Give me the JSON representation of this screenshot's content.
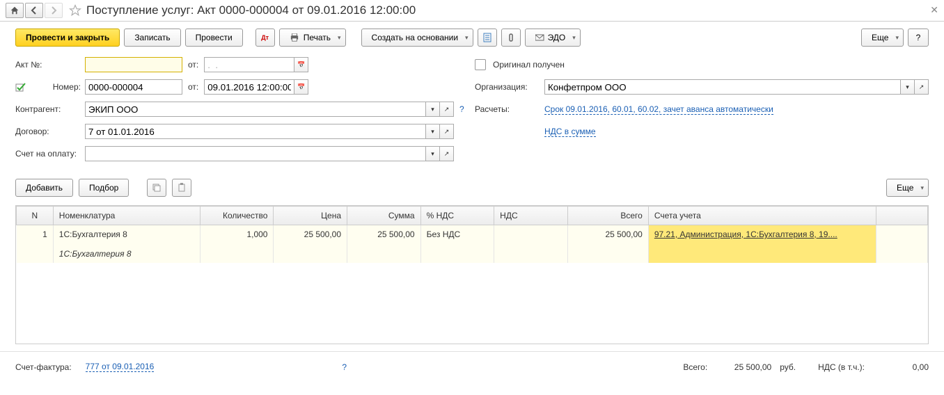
{
  "title": "Поступление услуг: Акт 0000-000004 от 09.01.2016 12:00:00",
  "toolbar": {
    "post_close": "Провести и закрыть",
    "save": "Записать",
    "post": "Провести",
    "print": "Печать",
    "create_based": "Создать на основании",
    "edo": "ЭДО",
    "more": "Еще",
    "help": "?"
  },
  "form": {
    "act_no_label": "Акт №:",
    "act_no_value": "",
    "from1": "от:",
    "date1": ".  .",
    "number_label": "Номер:",
    "number_value": "0000-000004",
    "from2": "от:",
    "date2": "09.01.2016 12:00:00",
    "counterparty_label": "Контрагент:",
    "counterparty_value": "ЭКИП ООО",
    "contract_label": "Договор:",
    "contract_value": "7 от 01.01.2016",
    "invoice_label": "Счет на оплату:",
    "invoice_value": "",
    "orig_received": "Оригинал получен",
    "org_label": "Организация:",
    "org_value": "Конфетпром ООО",
    "calc_label": "Расчеты:",
    "calc_link": "Срок 09.01.2016, 60.01, 60.02, зачет аванса автоматически",
    "vat_link": "НДС в сумме"
  },
  "actions": {
    "add": "Добавить",
    "pick": "Подбор",
    "more": "Еще"
  },
  "table": {
    "headers": {
      "n": "N",
      "nomen": "Номенклатура",
      "qty": "Количество",
      "price": "Цена",
      "sum": "Сумма",
      "vat_rate": "% НДС",
      "vat": "НДС",
      "total": "Всего",
      "accounts": "Счета учета"
    },
    "rows": [
      {
        "n": "1",
        "nomen1": "1С:Бухгалтерия 8",
        "nomen2": "1С:Бухгалтерия 8",
        "qty": "1,000",
        "price": "25 500,00",
        "sum": "25 500,00",
        "vat_rate": "Без НДС",
        "vat": "",
        "total": "25 500,00",
        "accounts": "97.21, Администрация, 1С:Бухгалтерия 8, 19...."
      }
    ]
  },
  "footer": {
    "sf_label": "Счет-фактура:",
    "sf_link": "777 от 09.01.2016",
    "total_label": "Всего:",
    "total_value": "25 500,00",
    "currency": "руб.",
    "vat_label": "НДС (в т.ч.):",
    "vat_value": "0,00"
  }
}
